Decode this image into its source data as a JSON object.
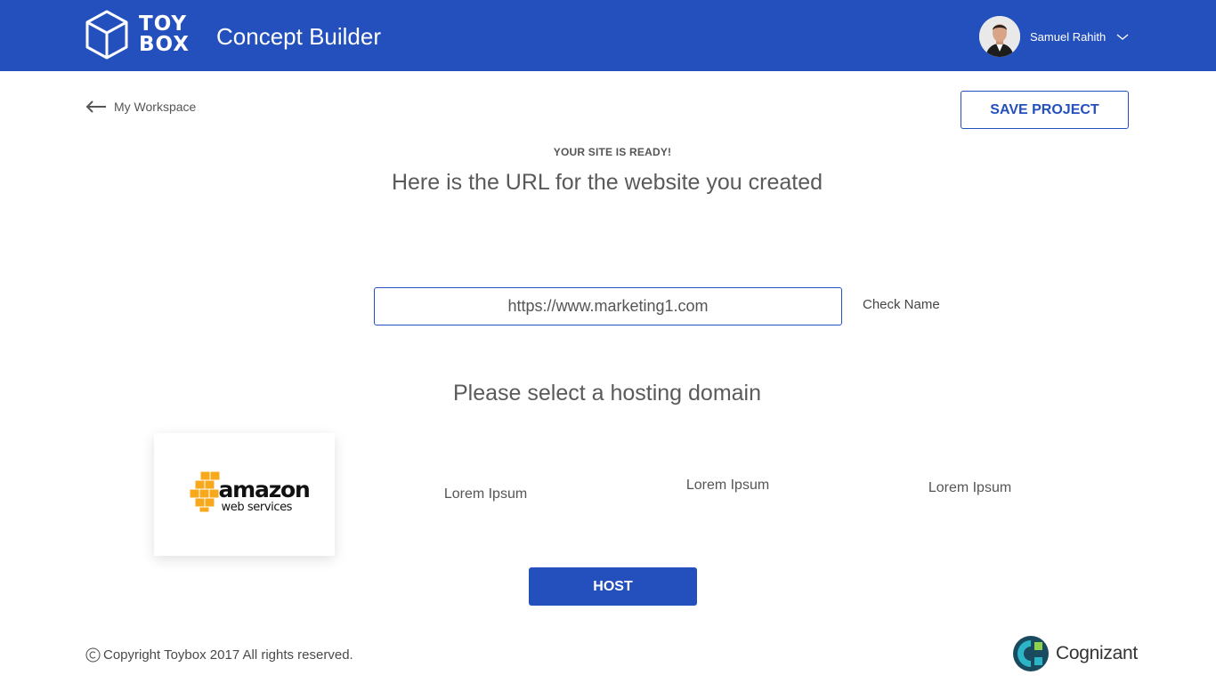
{
  "header": {
    "logo_top": "TOY",
    "logo_bottom": "BOX",
    "app_title": "Concept Builder",
    "user_name": "Samuel Rahith"
  },
  "nav": {
    "back_label": "My Workspace",
    "save_label": "SAVE PROJECT"
  },
  "main": {
    "status": "YOUR SITE IS READY!",
    "subtitle": "Here is the URL for the website you created",
    "url_value": "https://www.marketing1.com",
    "check_name_label": "Check Name",
    "hosting_heading": "Please select a hosting domain",
    "hosting_options": [
      {
        "name": "amazon",
        "sub": "web services",
        "selected": true
      },
      {
        "label": "Lorem Ipsum"
      },
      {
        "label": "Lorem Ipsum"
      },
      {
        "label": "Lorem Ipsum"
      }
    ],
    "host_label": "HOST"
  },
  "footer": {
    "copyright": "Copyright Toybox 2017 All rights reserved.",
    "partner": "Cognizant"
  },
  "colors": {
    "brand": "#2450be",
    "aws_orange": "#f7a81b"
  }
}
